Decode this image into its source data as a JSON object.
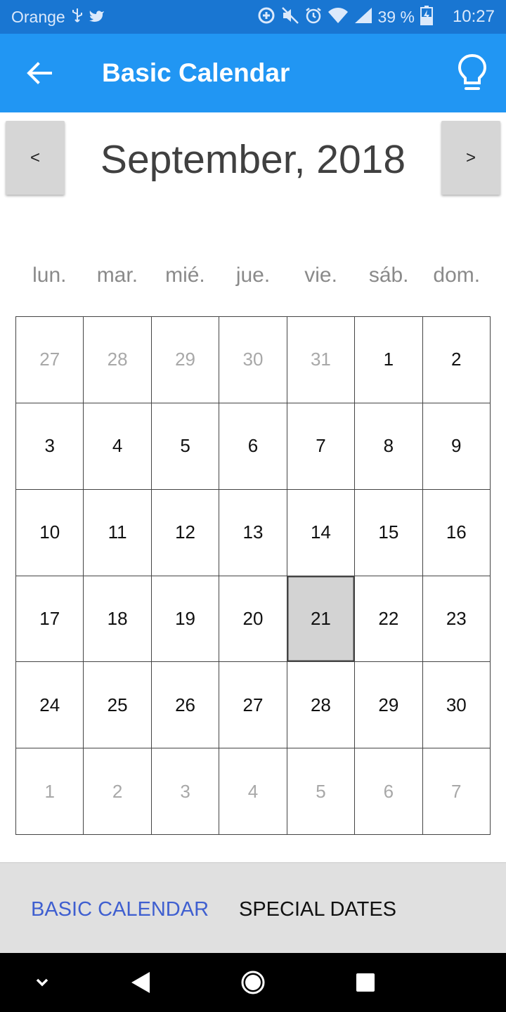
{
  "status_bar": {
    "carrier": "Orange",
    "battery": "39 %",
    "time": "10:27",
    "icons": [
      "usb-icon",
      "twitter-icon",
      "data-saver-icon",
      "mute-icon",
      "alarm-icon",
      "wifi-icon",
      "signal-icon",
      "battery-charging-icon"
    ]
  },
  "app_bar": {
    "title": "Basic Calendar",
    "back_icon": "arrow-back-icon",
    "action_icon": "lightbulb-icon",
    "color": "#2196F3"
  },
  "calendar": {
    "prev_label": "<",
    "next_label": ">",
    "month_title": "September, 2018",
    "weekdays": [
      "lun.",
      "mar.",
      "mié.",
      "jue.",
      "vie.",
      "sáb.",
      "dom."
    ],
    "days": [
      {
        "label": "27",
        "other": true
      },
      {
        "label": "28",
        "other": true
      },
      {
        "label": "29",
        "other": true
      },
      {
        "label": "30",
        "other": true
      },
      {
        "label": "31",
        "other": true
      },
      {
        "label": "1"
      },
      {
        "label": "2"
      },
      {
        "label": "3"
      },
      {
        "label": "4"
      },
      {
        "label": "5"
      },
      {
        "label": "6"
      },
      {
        "label": "7"
      },
      {
        "label": "8"
      },
      {
        "label": "9"
      },
      {
        "label": "10"
      },
      {
        "label": "11"
      },
      {
        "label": "12"
      },
      {
        "label": "13"
      },
      {
        "label": "14"
      },
      {
        "label": "15"
      },
      {
        "label": "16"
      },
      {
        "label": "17"
      },
      {
        "label": "18"
      },
      {
        "label": "19"
      },
      {
        "label": "20"
      },
      {
        "label": "21",
        "selected": true
      },
      {
        "label": "22"
      },
      {
        "label": "23"
      },
      {
        "label": "24"
      },
      {
        "label": "25"
      },
      {
        "label": "26"
      },
      {
        "label": "27"
      },
      {
        "label": "28"
      },
      {
        "label": "29"
      },
      {
        "label": "30"
      },
      {
        "label": "1",
        "other": true
      },
      {
        "label": "2",
        "other": true
      },
      {
        "label": "3",
        "other": true
      },
      {
        "label": "4",
        "other": true
      },
      {
        "label": "5",
        "other": true
      },
      {
        "label": "6",
        "other": true
      },
      {
        "label": "7",
        "other": true
      }
    ]
  },
  "tabs": {
    "basic": "BASIC CALENDAR",
    "special": "SPECIAL DATES",
    "active_color": "#3f5fd0"
  },
  "nav_bar": {
    "icons": [
      "chevron-down-icon",
      "back-triangle-icon",
      "home-circle-icon",
      "recents-square-icon"
    ]
  }
}
